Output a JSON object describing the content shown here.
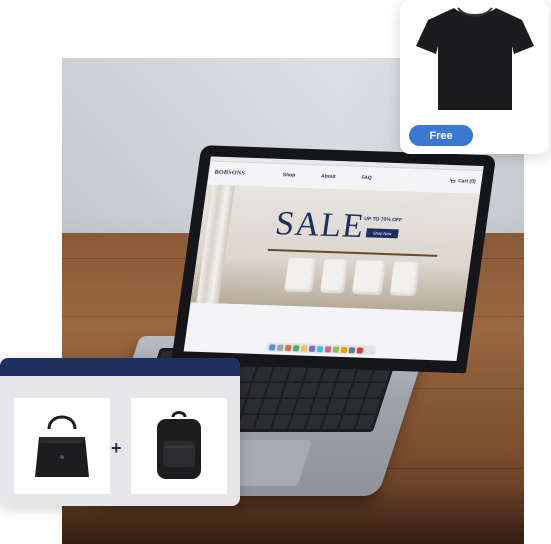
{
  "laptop_site": {
    "brand": "BOBSONS",
    "nav": [
      "Shop",
      "About",
      "FAQ"
    ],
    "cart_label": "Cart (0)",
    "hero_title": "SALE",
    "hero_offer": "UP TO 70% OFF",
    "hero_cta": "Shop Now"
  },
  "promo_card": {
    "product_icon": "t-shirt-icon",
    "button_label": "Free",
    "button_color": "#3a78d2"
  },
  "bundle": {
    "items": [
      {
        "icon": "handbag-icon"
      },
      {
        "icon": "backpack-icon"
      }
    ],
    "plus": "+",
    "header_color": "#1f3160"
  }
}
